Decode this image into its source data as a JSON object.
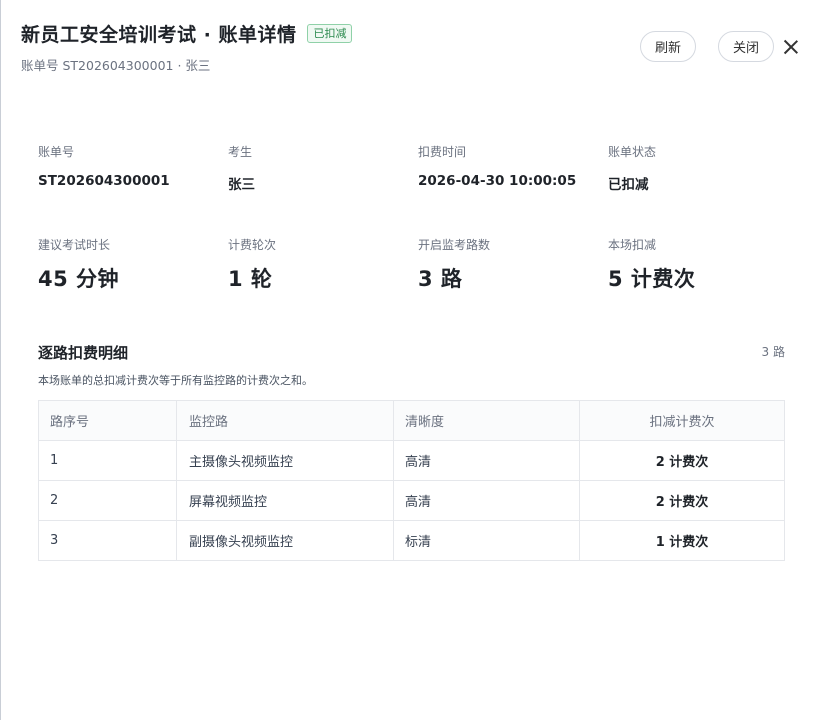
{
  "header": {
    "title": "新员工安全培训考试 · 账单详情",
    "status_badge": "已扣减",
    "subtitle": "账单号 ST202604300001 · 张三",
    "refresh_label": "刷新",
    "close_label": "关闭"
  },
  "summary": {
    "bill_no": {
      "label": "账单号",
      "value": "ST202604300001"
    },
    "examinee": {
      "label": "考生",
      "value": "张三"
    },
    "charge_time": {
      "label": "扣费时间",
      "value": "2026-04-30 10:00:05"
    },
    "bill_status": {
      "label": "账单状态",
      "value": "已扣减"
    },
    "duration": {
      "label": "建议考试时长",
      "value": "45 分钟"
    },
    "rounds": {
      "label": "计费轮次",
      "value": "1 轮"
    },
    "streams": {
      "label": "开启监考路数",
      "value": "3 路"
    },
    "deduction": {
      "label": "本场扣减",
      "value": "5 计费次"
    }
  },
  "detail": {
    "title": "逐路扣费明细",
    "count": "3 路",
    "description": "本场账单的总扣减计费次等于所有监控路的计费次之和。",
    "columns": [
      "路序号",
      "监控路",
      "清晰度",
      "扣减计费次"
    ],
    "rows": [
      [
        "1",
        "主摄像头视频监控",
        "高清",
        "2 计费次"
      ],
      [
        "2",
        "屏幕视频监控",
        "高清",
        "2 计费次"
      ],
      [
        "3",
        "副摄像头视频监控",
        "标清",
        "1 计费次"
      ]
    ]
  }
}
